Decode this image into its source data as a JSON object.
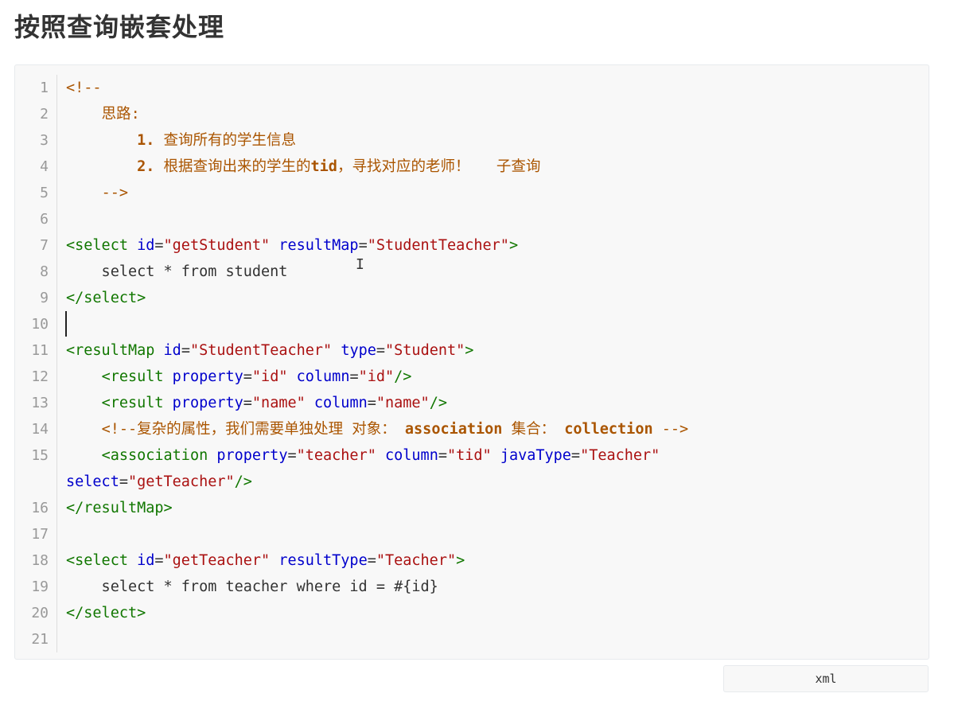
{
  "heading": "按照查询嵌套处理",
  "code": {
    "language": "xml",
    "line_numbers": [
      "1",
      "2",
      "3",
      "4",
      "5",
      "6",
      "7",
      "8",
      "9",
      "10",
      "11",
      "12",
      "13",
      "14",
      "15",
      "16",
      "17",
      "18",
      "19",
      "20",
      "21"
    ],
    "lines": [
      "<!--",
      "    思路:",
      "        1. 查询所有的学生信息",
      "        2. 根据查询出来的学生的tid，寻找对应的老师！   子查询",
      "    -->",
      "",
      "<select id=\"getStudent\" resultMap=\"StudentTeacher\">",
      "    select * from student",
      "</select>",
      "",
      "<resultMap id=\"StudentTeacher\" type=\"Student\">",
      "    <result property=\"id\" column=\"id\"/>",
      "    <result property=\"name\" column=\"name\"/>",
      "    <!--复杂的属性，我们需要单独处理 对象： association 集合： collection -->",
      "    <association property=\"teacher\" column=\"tid\" javaType=\"Teacher\" select=\"getTeacher\"/>",
      "</resultMap>",
      "",
      "<select id=\"getTeacher\" resultType=\"Teacher\">",
      "    select * from teacher where id = #{id}",
      "</select>",
      ""
    ]
  },
  "colors": {
    "comment": "#aa5500",
    "tag": "#117700",
    "attribute": "#0000cc",
    "string": "#aa1111",
    "line_number": "#999999",
    "code_background": "#f8f8f8"
  },
  "icons": {
    "text_cursor": "i-beam-cursor-icon"
  }
}
